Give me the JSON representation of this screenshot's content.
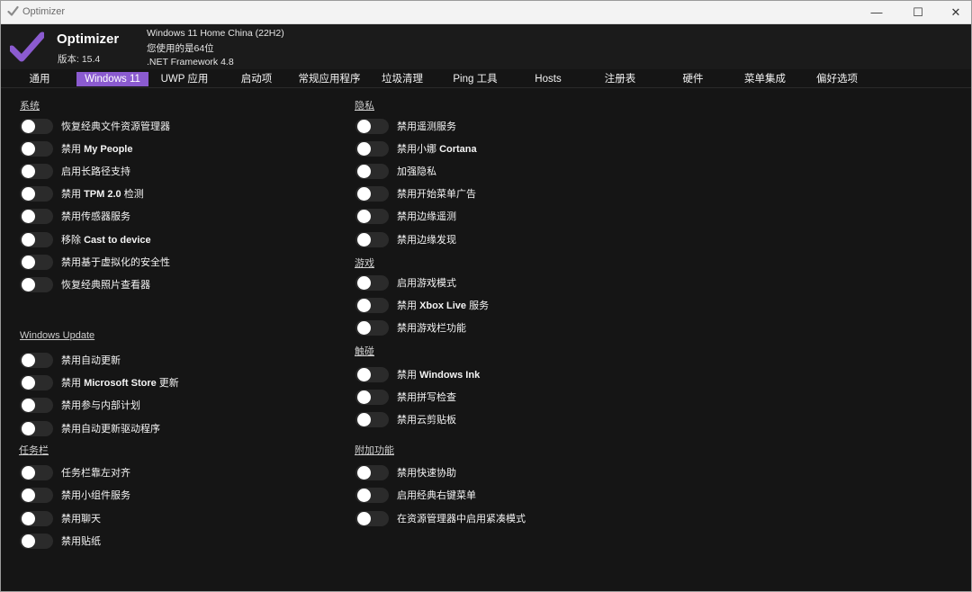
{
  "window": {
    "title": "Optimizer",
    "minimize_glyph": "—",
    "maximize_glyph": "☐",
    "close_glyph": "✕"
  },
  "header": {
    "app_name": "Optimizer",
    "version": "版本: 15.4",
    "os": "Windows 11 Home China (22H2)",
    "arch": "您使用的是64位",
    "framework": ".NET Framework 4.8"
  },
  "tabs": [
    {
      "label": "通用",
      "active": false
    },
    {
      "label": "Windows 11",
      "active": true
    },
    {
      "label": "UWP 应用",
      "active": false
    },
    {
      "label": "启动项",
      "active": false
    },
    {
      "label": "常规应用程序",
      "active": false
    },
    {
      "label": "垃圾清理",
      "active": false
    },
    {
      "label": "Ping 工具",
      "active": false
    },
    {
      "label": "Hosts",
      "active": false
    },
    {
      "label": "注册表",
      "active": false
    },
    {
      "label": "硬件",
      "active": false
    },
    {
      "label": "菜单集成",
      "active": false
    },
    {
      "label": "偏好选项",
      "active": false
    }
  ],
  "sections": {
    "system": {
      "title": "系统",
      "items": [
        {
          "label": "恢复经典文件资源管理器",
          "checked": false
        },
        {
          "label": "禁用 My People",
          "checked": false
        },
        {
          "label": "启用长路径支持",
          "checked": false
        },
        {
          "label": "禁用 TPM 2.0 检测",
          "checked": false
        },
        {
          "label": "禁用传感器服务",
          "checked": false
        },
        {
          "label": "移除 Cast to device",
          "checked": false
        },
        {
          "label": "禁用基于虚拟化的安全性",
          "checked": false
        },
        {
          "label": "恢复经典照片查看器",
          "checked": false
        }
      ]
    },
    "windows_update": {
      "title": "Windows Update",
      "items": [
        {
          "label": "禁用自动更新",
          "checked": false
        },
        {
          "label": "禁用 Microsoft Store 更新",
          "checked": false
        },
        {
          "label": "禁用参与内部计划",
          "checked": false
        },
        {
          "label": "禁用自动更新驱动程序",
          "checked": false
        }
      ]
    },
    "taskbar": {
      "title": "任务栏",
      "items": [
        {
          "label": "任务栏靠左对齐",
          "checked": false
        },
        {
          "label": "禁用小组件服务",
          "checked": false
        },
        {
          "label": "禁用聊天",
          "checked": false
        },
        {
          "label": "禁用贴纸",
          "checked": false
        }
      ]
    },
    "privacy": {
      "title": "隐私",
      "items": [
        {
          "label": "禁用遥测服务",
          "checked": false
        },
        {
          "label": "禁用小娜 Cortana",
          "checked": false
        },
        {
          "label": "加强隐私",
          "checked": false
        },
        {
          "label": "禁用开始菜单广告",
          "checked": false
        },
        {
          "label": "禁用边缘遥测",
          "checked": false
        },
        {
          "label": "禁用边缘发现",
          "checked": false
        }
      ]
    },
    "gaming": {
      "title": "游戏",
      "items": [
        {
          "label": "启用游戏模式",
          "checked": false
        },
        {
          "label": "禁用 Xbox Live 服务",
          "checked": false
        },
        {
          "label": "禁用游戏栏功能",
          "checked": false
        }
      ]
    },
    "touch": {
      "title": "触碰",
      "items": [
        {
          "label": "禁用 Windows Ink",
          "checked": false
        },
        {
          "label": "禁用拼写检查",
          "checked": false
        },
        {
          "label": "禁用云剪贴板",
          "checked": false
        }
      ]
    },
    "extras": {
      "title": "附加功能",
      "items": [
        {
          "label": "禁用快速协助",
          "checked": false
        },
        {
          "label": "启用经典右键菜单",
          "checked": false
        },
        {
          "label": "在资源管理器中启用紧凑模式",
          "checked": false
        }
      ]
    }
  },
  "colors": {
    "accent": "#8b5bd0",
    "background": "#151515",
    "toggle_off": "#2b2b2b"
  },
  "icons": {
    "app": "checkmark-logo"
  }
}
